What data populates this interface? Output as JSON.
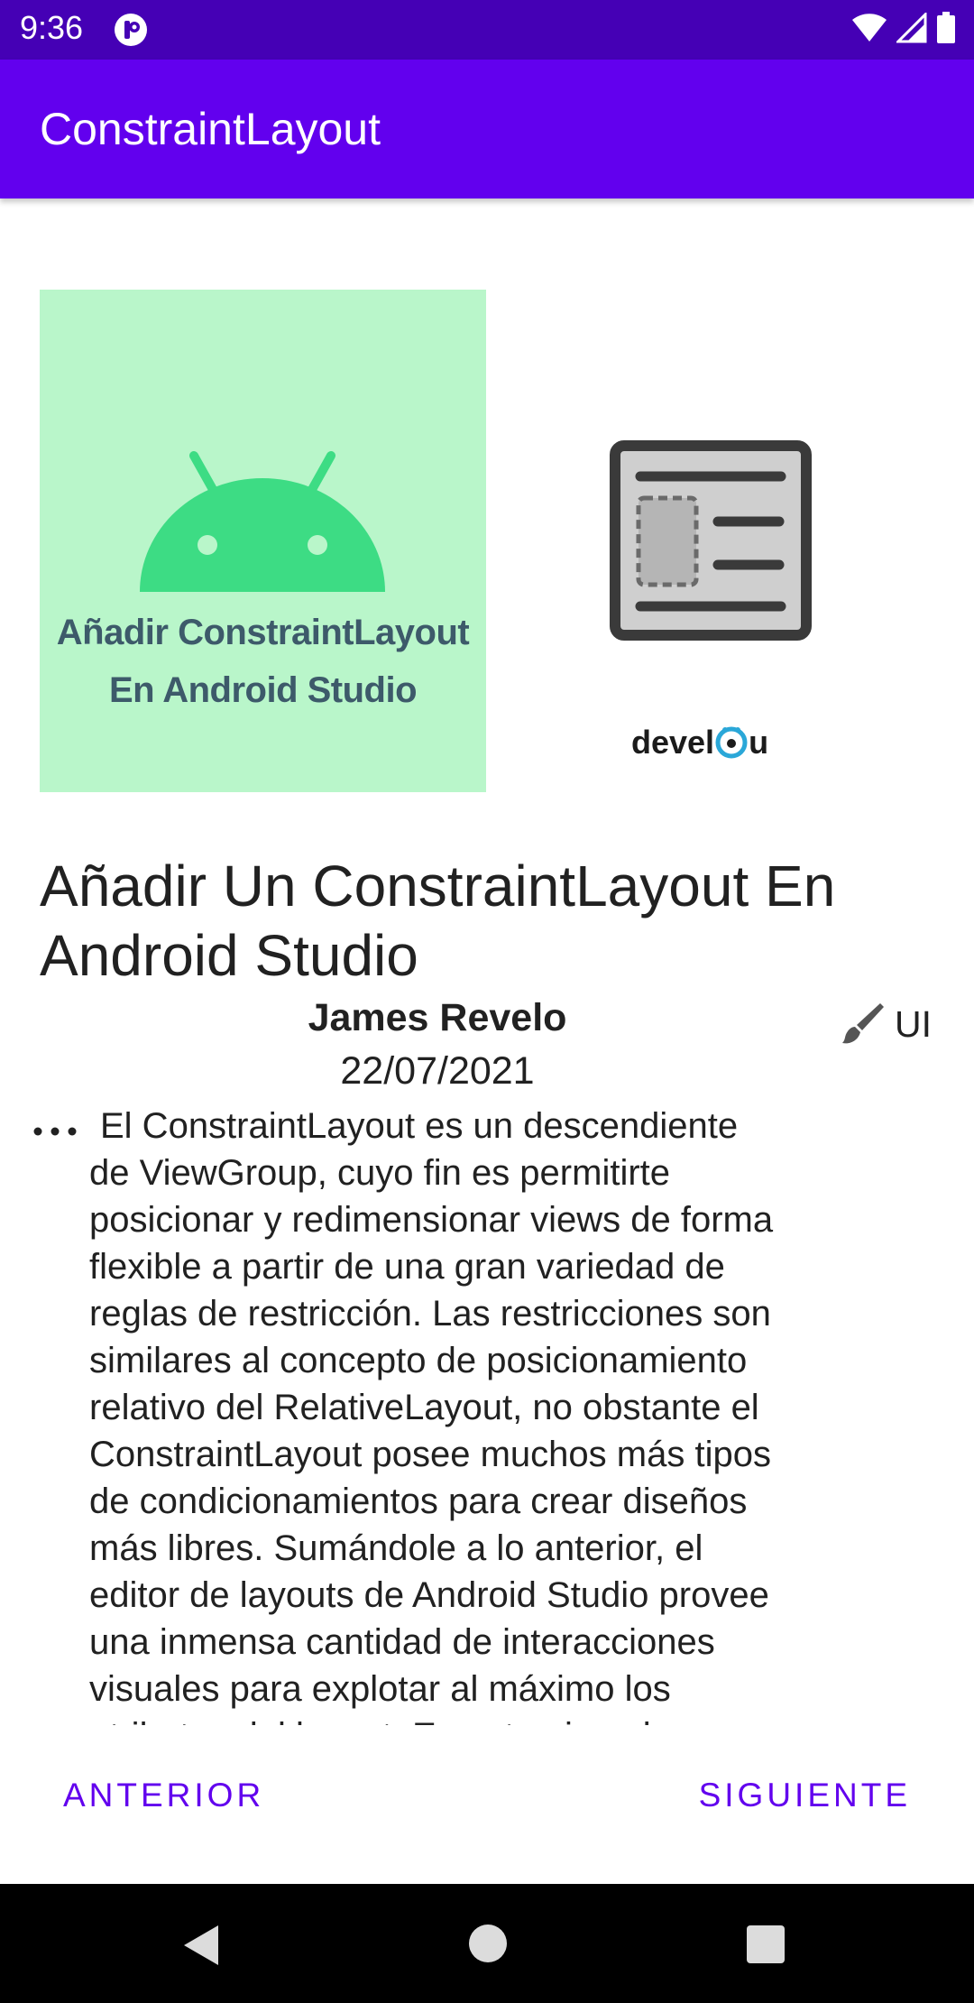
{
  "status_bar": {
    "time": "9:36",
    "icons": [
      "app-notification-icon",
      "wifi-icon",
      "signal-icon",
      "battery-icon"
    ]
  },
  "app_bar": {
    "title": "ConstraintLayout"
  },
  "article": {
    "image_caption_line1": "Añadir ConstraintLayout",
    "image_caption_line2": "En Android Studio",
    "brand_left": "devel",
    "brand_right": "u",
    "title": "Añadir Un ConstraintLayout En Android Studio",
    "author": "James Revelo",
    "date": "22/07/2021",
    "category": "UI",
    "content": "El ConstraintLayout es un descendiente\nde ViewGroup, cuyo fin es permitirte\nposicionar y redimensionar views de forma\nflexible a partir de una gran variedad de\nreglas de restricción.  Las restricciones son\nsimilares al concepto de posicionamiento\nrelativo del RelativeLayout, no obstante el\nConstraintLayout posee muchos más tipos\nde condicionamientos para crear diseños\nmás libres.  Sumándole a lo anterior, el\neditor de layouts de Android Studio provee\nuna inmensa cantidad de interacciones\nvisuales para explotar al máximo los\natributos del layout. En este ejemplo\naprenderás a usar el ConstraintLayout."
  },
  "buttons": {
    "previous": "ANTERIOR",
    "next": "SIGUIENTE"
  },
  "colors": {
    "primary": "#6200ee",
    "primary_dark": "#4500b5",
    "image_background": "#b9f6ca",
    "android_green": "#3ddc84"
  }
}
